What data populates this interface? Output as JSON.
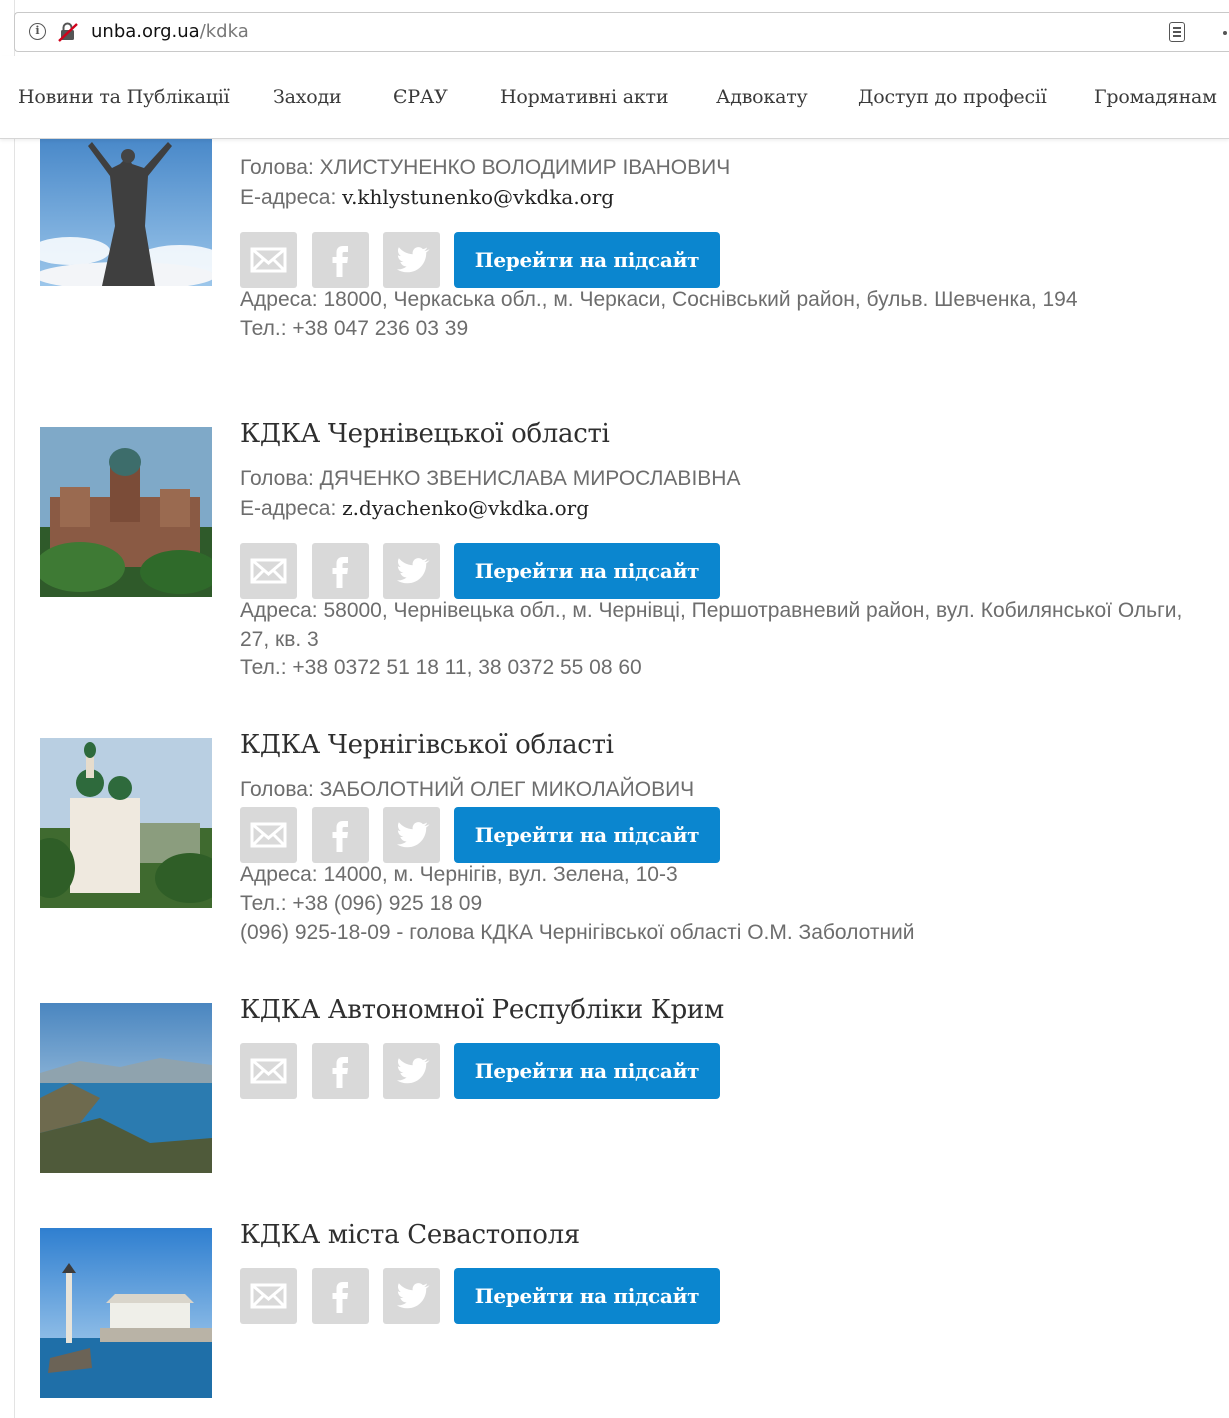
{
  "browser": {
    "url_host": "unba.org.ua",
    "url_path": "/kdka"
  },
  "nav": {
    "items": [
      "Новини та Публікації",
      "Заходи",
      "ЄРАУ",
      "Нормативні акти",
      "Адвокату",
      "Доступ до професії",
      "Громадянам"
    ]
  },
  "entries": [
    {
      "title": "",
      "thumb_icon": "statue-photo",
      "lines": [
        {
          "label": "Голова: ",
          "value": "ХЛИСТУНЕНКО ВОЛОДИМИР ІВАНОВИЧ"
        },
        {
          "label": "Е-адреса: ",
          "value": "v.khlystunenko@vkdka.org"
        }
      ],
      "details": [
        "Адреса: 18000, Черкаська обл., м. Черкаси, Соснівський район, бульв. Шевченка, 194",
        "Тел.: +38 047 236 03 39"
      ]
    },
    {
      "title": "КДКА Чернівецької області",
      "thumb_icon": "university-photo",
      "lines": [
        {
          "label": "Голова: ",
          "value": "ДЯЧЕНКО ЗВЕНИСЛАВА МИРОСЛАВІВНА"
        },
        {
          "label": "Е-адреса: ",
          "value": "z.dyachenko@vkdka.org"
        }
      ],
      "details": [
        "Адреса: 58000, Чернівецька обл., м. Чернівці, Першотравневий район, вул. Кобилянської Ольги,",
        "27, кв. 3",
        "Тел.: +38 0372 51 18 11, 38 0372 55 08 60"
      ]
    },
    {
      "title": "КДКА Чернігівської області",
      "thumb_icon": "monastery-photo",
      "lines": [
        {
          "label": "Голова: ",
          "value": "ЗАБОЛОТНИЙ ОЛЕГ МИКОЛАЙОВИЧ"
        }
      ],
      "details": [
        "Адреса: 14000, м. Чернігів, вул. Зелена, 10-3",
        "Тел.: +38 (096) 925 18 09",
        "(096) 925-18-09 - голова КДКА Чернігівської області О.М. Заболотний"
      ]
    },
    {
      "title": "КДКА Автономної Республіки Крим",
      "thumb_icon": "coast-photo",
      "lines": [],
      "details": []
    },
    {
      "title": "КДКА міста Севастополя",
      "thumb_icon": "monument-sea-photo",
      "lines": [],
      "details": []
    }
  ],
  "buttons": {
    "subsite_label": "Перейти на підсайт"
  },
  "colors": {
    "accent": "#0b86cf",
    "icon_tile": "#d9d9d9"
  }
}
